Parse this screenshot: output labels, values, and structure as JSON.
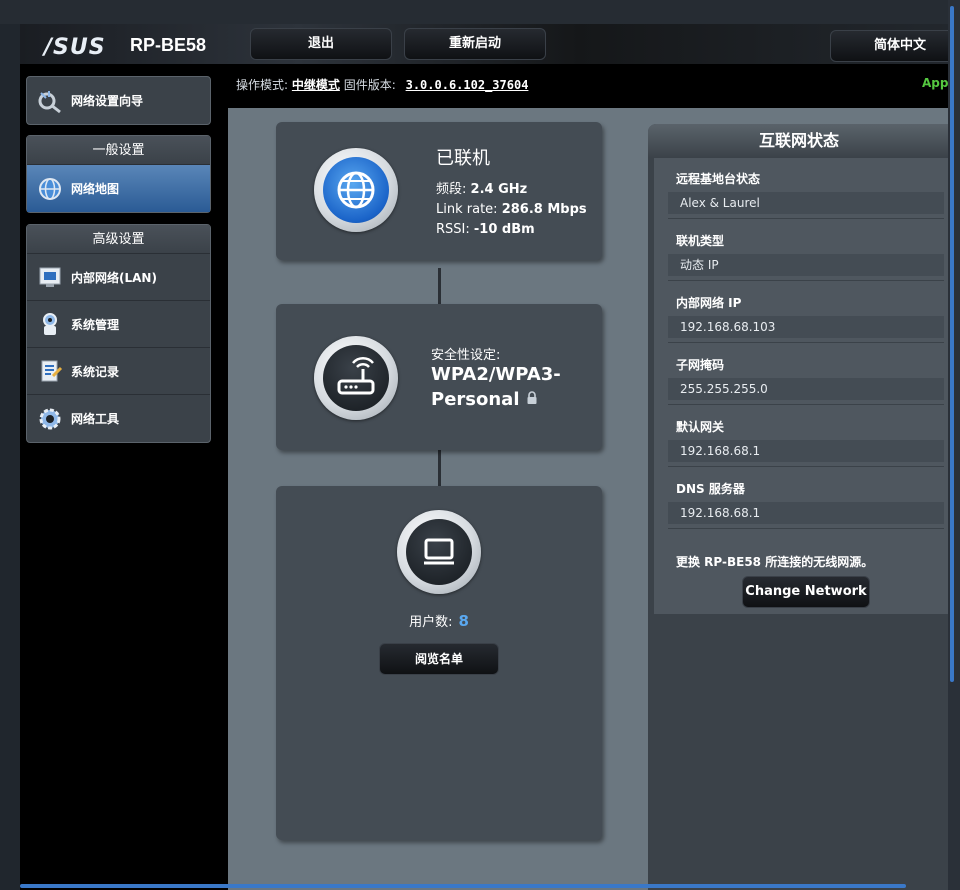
{
  "header": {
    "logo": "/SUS",
    "model": "RP-BE58",
    "logout_label": "退出",
    "reboot_label": "重新启动",
    "language": "简体中文"
  },
  "status": {
    "mode_label": "操作模式:",
    "mode_value": "中继模式",
    "firmware_label": "固件版本:",
    "firmware_value": "3.0.0.6.102_37604",
    "app_link": "App"
  },
  "sidebar": {
    "wizard": {
      "label": "网络设置向导",
      "icon": "wizard-icon"
    },
    "general": {
      "header": "一般设置",
      "items": [
        {
          "label": "网络地图",
          "icon": "globe-map-icon",
          "active": true
        }
      ]
    },
    "advanced": {
      "header": "高级设置",
      "items": [
        {
          "label": "内部网络(LAN)",
          "icon": "lan-icon"
        },
        {
          "label": "系统管理",
          "icon": "system-admin-icon"
        },
        {
          "label": "系统记录",
          "icon": "system-log-icon"
        },
        {
          "label": "网络工具",
          "icon": "network-tools-icon"
        }
      ]
    }
  },
  "map": {
    "internet": {
      "state": "已联机",
      "band_label": "频段:",
      "band_value": "2.4 GHz",
      "linkrate_label": "Link rate:",
      "linkrate_value": "286.8 Mbps",
      "rssi_label": "RSSI:",
      "rssi_value": "-10 dBm"
    },
    "security": {
      "label": "安全性设定:",
      "value_line1": "WPA2/WPA3-",
      "value_line2": "Personal"
    },
    "clients": {
      "label": "用户数:",
      "count": "8",
      "view_list_label": "阅览名单"
    }
  },
  "internet_status": {
    "title": "互联网状态",
    "fields": [
      {
        "label": "远程基地台状态",
        "value": "Alex & Laurel"
      },
      {
        "label": "联机类型",
        "value": "动态 IP"
      },
      {
        "label": "内部网络 IP",
        "value": "192.168.68.103"
      },
      {
        "label": "子网掩码",
        "value": "255.255.255.0"
      },
      {
        "label": "默认网关",
        "value": "192.168.68.1"
      },
      {
        "label": "DNS 服务器",
        "value": "192.168.68.1"
      }
    ],
    "change_text": "更换 RP-BE58 所连接的无线网源。",
    "change_button": "Change Network"
  },
  "colors": {
    "accent_blue": "#3a78c8",
    "client_count": "#5aa8f0",
    "app_green": "#55c840",
    "active_menu": "#2b5b95"
  }
}
